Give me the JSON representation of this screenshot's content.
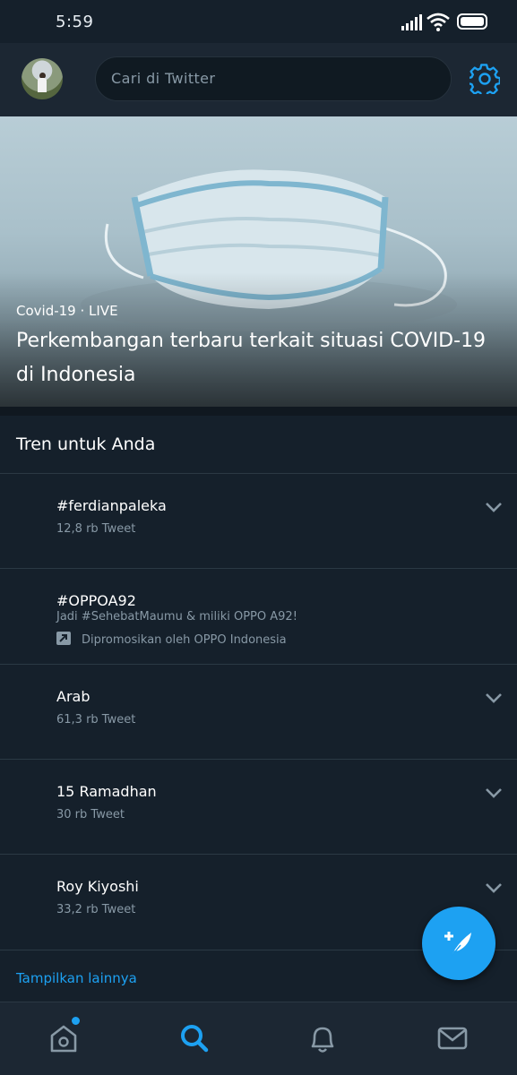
{
  "status_bar": {
    "time": "5:59"
  },
  "top_bar": {
    "search_placeholder": "Cari di Twitter"
  },
  "hero": {
    "kicker": "Covid-19 · LIVE",
    "headline": "Perkembangan terbaru terkait situasi COVID-19 di Indonesia"
  },
  "section": {
    "title": "Tren untuk Anda"
  },
  "trends": [
    {
      "name": "#ferdianpaleka",
      "count": "12,8 rb Tweet"
    },
    {
      "name": "#OPPOA92",
      "description": "Jadi #SehebatMaumu & miliki OPPO A92!",
      "promoted": "Dipromosikan oleh OPPO Indonesia"
    },
    {
      "name": "Arab",
      "count": "61,3 rb Tweet"
    },
    {
      "name": "15 Ramadhan",
      "count": "30 rb Tweet"
    },
    {
      "name": "Roy Kiyoshi",
      "count": "33,2 rb Tweet"
    }
  ],
  "show_more": "Tampilkan lainnya",
  "bottom_nav": [
    "home-icon",
    "search-icon",
    "notifications-icon",
    "messages-icon"
  ],
  "colors": {
    "accent": "#1da1f2",
    "background": "#15202b",
    "bar": "#1c2733",
    "muted": "#8899a6"
  }
}
